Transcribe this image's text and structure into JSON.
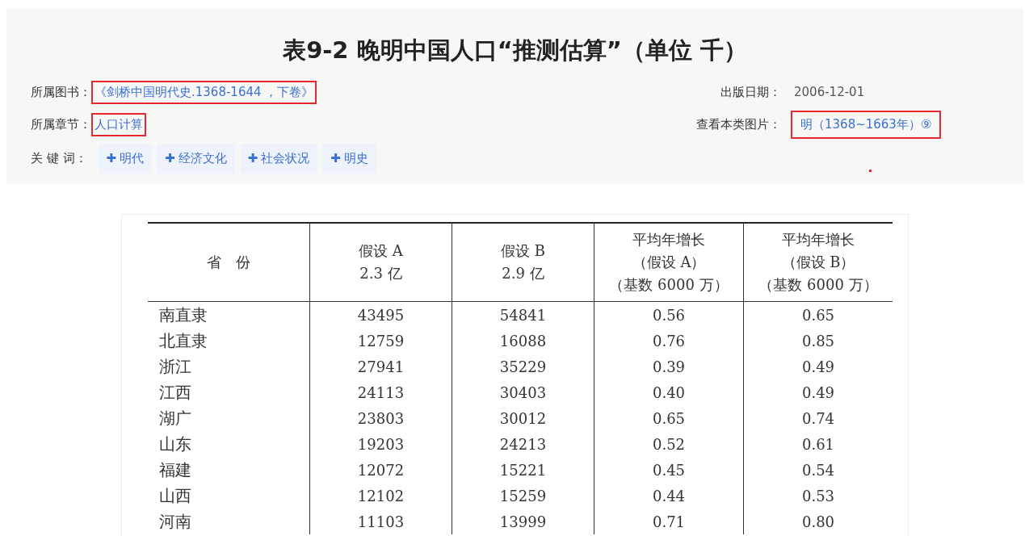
{
  "title": "表9-2 晚明中国人口“推测估算”（单位 千）",
  "meta_left": [
    {
      "label": "所属图书：",
      "value": "《剑桥中国明代史.1368-1644 ，下卷》",
      "highlighted": true
    },
    {
      "label": "所属章节：",
      "value": "人口计算",
      "highlighted": true
    }
  ],
  "meta_right": [
    {
      "label": "出版日期：",
      "value": "2006-12-01",
      "kind": "text",
      "highlighted": false
    },
    {
      "label": "查看本类图片：",
      "value": "明（1368~1663年）⑨",
      "kind": "link",
      "highlighted": true
    }
  ],
  "keywords": {
    "label": "关 键 词：",
    "icon": "✚",
    "tags": [
      "明代",
      "经济文化",
      "社会状况",
      "明史"
    ]
  },
  "table": {
    "columns": [
      {
        "lines": [
          "省　份"
        ]
      },
      {
        "lines": [
          "假设 A",
          "2.3 亿"
        ]
      },
      {
        "lines": [
          "假设 B",
          "2.9 亿"
        ]
      },
      {
        "lines": [
          "平均年增长",
          "（假设 A）",
          "（基数 6000 万）"
        ]
      },
      {
        "lines": [
          "平均年增长",
          "（假设 B）",
          "（基数 6000 万）"
        ]
      }
    ],
    "rows": [
      [
        "南直隶",
        "43495",
        "54841",
        "0.56",
        "0.65"
      ],
      [
        "北直隶",
        "12759",
        "16088",
        "0.76",
        "0.85"
      ],
      [
        "浙江",
        "27941",
        "35229",
        "0.39",
        "0.49"
      ],
      [
        "江西",
        "24113",
        "30403",
        "0.40",
        "0.49"
      ],
      [
        "湖广",
        "23803",
        "30012",
        "0.65",
        "0.74"
      ],
      [
        "山东",
        "19203",
        "24213",
        "0.52",
        "0.61"
      ],
      [
        "福建",
        "12072",
        "15221",
        "0.45",
        "0.54"
      ],
      [
        "山西",
        "12102",
        "15259",
        "0.44",
        "0.53"
      ],
      [
        "河南",
        "11103",
        "13999",
        "0.71",
        "0.80"
      ]
    ]
  }
}
